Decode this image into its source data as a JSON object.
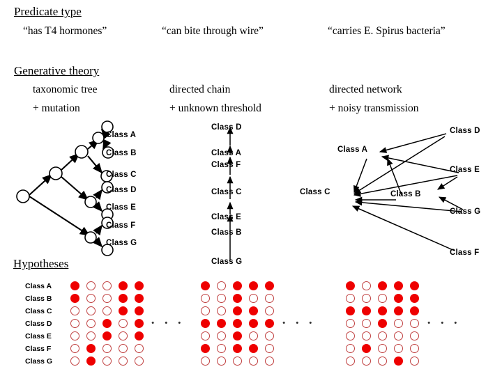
{
  "predicate_section": {
    "title": "Predicate type",
    "items": [
      "“has T4 hormones”",
      "“can bite through wire”",
      "“carries E. Spirus bacteria”"
    ]
  },
  "theory_section": {
    "title": "Generative theory",
    "columns": [
      {
        "line1": "taxonomic tree",
        "line2": "+ mutation"
      },
      {
        "line1": "directed chain",
        "line2": "+ unknown threshold"
      },
      {
        "line1": "directed network",
        "line2": "+ noisy transmission"
      }
    ]
  },
  "tree_diagram": {
    "leaf_labels": [
      "Class A",
      "Class B",
      "Class C",
      "Class D",
      "Class E",
      "Class F",
      "Class G"
    ]
  },
  "chain_diagram": {
    "order_bottom_to_top": [
      "Class G",
      "Class B",
      "Class E",
      "Class C",
      "Class F",
      "Class A",
      "Class D"
    ],
    "labels_top_to_bottom": [
      "Class D",
      "Class A",
      "Class F",
      "Class C",
      "Class E",
      "Class B",
      "Class G"
    ]
  },
  "network_diagram": {
    "labels": [
      "Class D",
      "Class A",
      "Class E",
      "Class C",
      "Class B",
      "Class G",
      "Class F"
    ],
    "edges": [
      "Class D -> Class A",
      "Class D -> Class C",
      "Class E -> Class A",
      "Class E -> Class C",
      "Class E -> Class B",
      "Class B -> Class A",
      "Class B -> Class C",
      "Class G -> Class B",
      "Class G -> Class C",
      "Class A -> Class C",
      "Class F -> Class C"
    ]
  },
  "hypotheses": {
    "title": "Hypotheses",
    "row_labels": [
      "Class A",
      "Class B",
      "Class C",
      "Class D",
      "Class E",
      "Class F",
      "Class G"
    ],
    "ellipsis": "· · ·",
    "on_color": "#ee0000",
    "off_color": "#ffffff",
    "grids": [
      {
        "rows": [
          [
            1,
            0,
            0,
            1,
            1
          ],
          [
            1,
            0,
            0,
            1,
            1
          ],
          [
            0,
            0,
            0,
            1,
            1
          ],
          [
            0,
            0,
            1,
            0,
            1
          ],
          [
            0,
            0,
            1,
            0,
            1
          ],
          [
            0,
            1,
            0,
            0,
            0
          ],
          [
            0,
            1,
            0,
            0,
            0
          ]
        ]
      },
      {
        "rows": [
          [
            1,
            0,
            1,
            1,
            1
          ],
          [
            0,
            0,
            1,
            0,
            0
          ],
          [
            0,
            0,
            1,
            1,
            0
          ],
          [
            1,
            1,
            1,
            1,
            1
          ],
          [
            0,
            0,
            1,
            0,
            0
          ],
          [
            1,
            0,
            1,
            1,
            0
          ],
          [
            0,
            0,
            0,
            0,
            0
          ]
        ]
      },
      {
        "rows": [
          [
            1,
            0,
            1,
            1,
            1
          ],
          [
            0,
            0,
            0,
            1,
            1
          ],
          [
            1,
            1,
            1,
            1,
            1
          ],
          [
            0,
            0,
            1,
            0,
            0
          ],
          [
            0,
            0,
            0,
            0,
            0
          ],
          [
            0,
            1,
            0,
            0,
            0
          ],
          [
            0,
            0,
            0,
            1,
            0
          ]
        ]
      }
    ]
  }
}
